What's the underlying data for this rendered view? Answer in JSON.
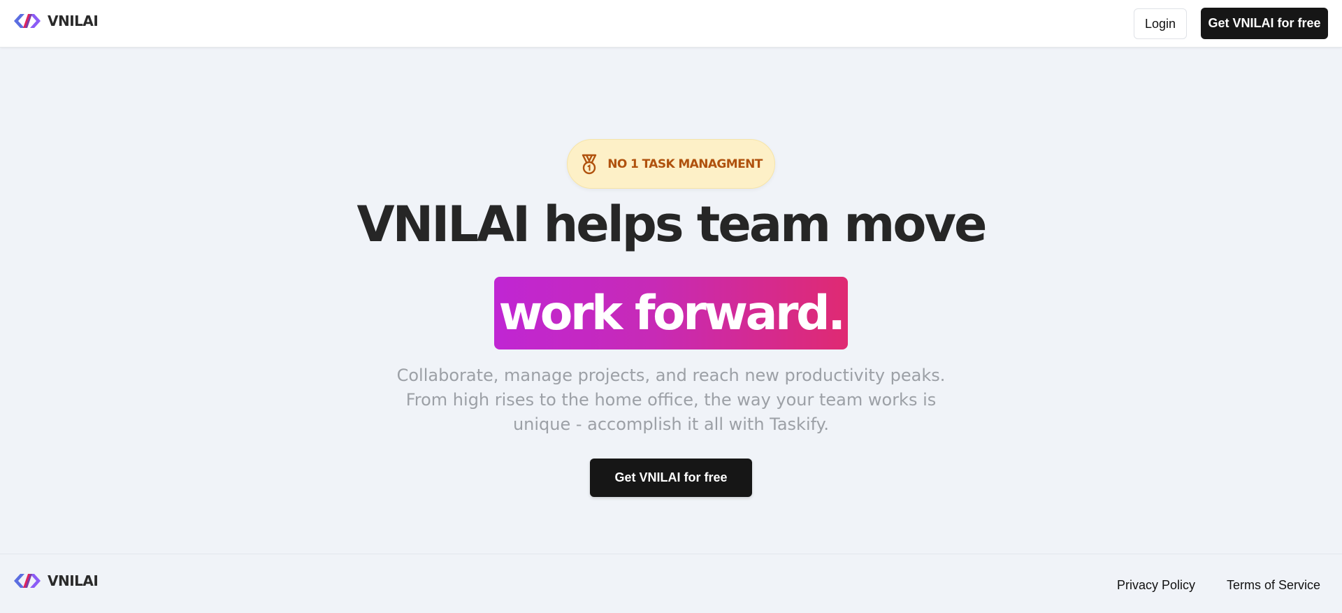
{
  "header": {
    "brand": "VNILAI",
    "login_label": "Login",
    "cta_label": "Get VNILAI for free"
  },
  "hero": {
    "badge_icon": "medal-icon",
    "badge_text": "NO 1 TASK MANAGMENT",
    "headline": "VNILAI helps team move",
    "highlight": "work forward.",
    "subtext_lines": [
      "Collaborate, manage projects, and reach new productivity peaks.",
      "From high rises to the home office, the way your team works is",
      "unique - accomplish it all with Taskify."
    ],
    "cta_label": "Get VNILAI for free"
  },
  "footer": {
    "brand": "VNILAI",
    "links": [
      "Privacy Policy",
      "Terms of Service"
    ]
  },
  "colors": {
    "background": "#f0f3f8",
    "dark_button": "#161616",
    "badge_bg": "#fdf0c7",
    "badge_text": "#b0520e",
    "gradient_start": "#c026d3",
    "gradient_end": "#df2a72"
  }
}
